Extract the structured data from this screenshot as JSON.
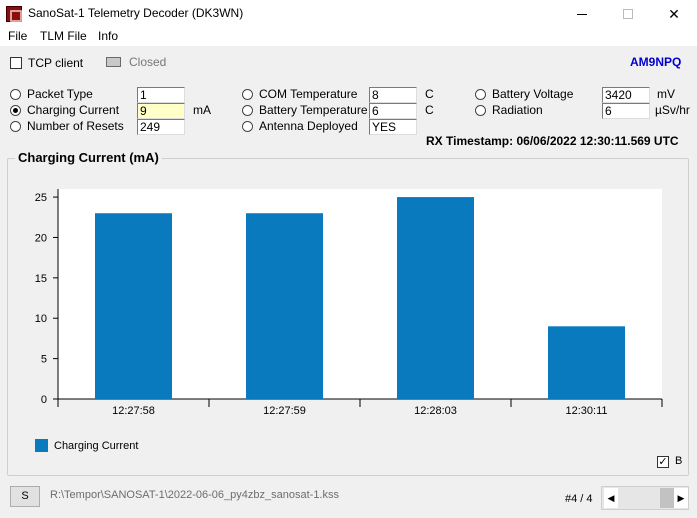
{
  "window": {
    "title": "SanoSat-1 Telemetry Decoder (DK3WN)"
  },
  "menu": [
    "File",
    "TLM File",
    "Info"
  ],
  "connection": {
    "tcp_label": "TCP client",
    "status": "Closed"
  },
  "callsign": "AM9NPQ",
  "params": {
    "packet_type": {
      "label": "Packet Type",
      "value": "1",
      "unit": ""
    },
    "charging_current": {
      "label": "Charging Current",
      "value": "9",
      "unit": "mA"
    },
    "number_of_resets": {
      "label": "Number of Resets",
      "value": "249",
      "unit": ""
    },
    "com_temperature": {
      "label": "COM Temperature",
      "value": "8",
      "unit": "C"
    },
    "battery_temperature": {
      "label": "Battery Temperature",
      "value": "6",
      "unit": "C"
    },
    "antenna_deployed": {
      "label": "Antenna Deployed",
      "value": "YES",
      "unit": ""
    },
    "battery_voltage": {
      "label": "Battery Voltage",
      "value": "3420",
      "unit": "mV"
    },
    "radiation": {
      "label": "Radiation",
      "value": "6",
      "unit": "µSv/hr"
    }
  },
  "selected_param": "charging_current",
  "timestamp": "RX Timestamp: 06/06/2022 12:30:11.569 UTC",
  "chart_data": {
    "type": "bar",
    "title": "Charging Current (mA)",
    "categories": [
      "12:27:58",
      "12:27:59",
      "12:28:03",
      "12:30:11"
    ],
    "series": [
      {
        "name": "Charging Current",
        "values": [
          23,
          23,
          25,
          9
        ],
        "color": "#0a7abf"
      }
    ],
    "yticks": [
      0,
      5,
      10,
      15,
      20,
      25
    ],
    "ylim": [
      0,
      26
    ],
    "legend": "bottom-left",
    "grid": false
  },
  "b_label": "B",
  "bottom": {
    "s_label": "S",
    "file_path": "R:\\Tempor\\SANOSAT-1\\2022-06-06_py4zbz_sanosat-1.kss",
    "record": "#4 / 4"
  }
}
